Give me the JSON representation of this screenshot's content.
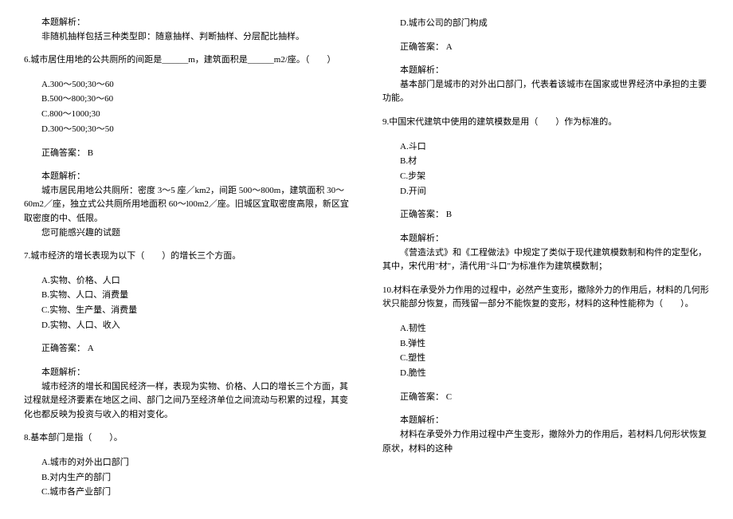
{
  "intro": {
    "heading": "本题解析：",
    "text": "非随机抽样包括三种类型即：随意抽样、判断抽样、分层配比抽样。"
  },
  "q6": {
    "stem": "6.城市居住用地的公共厕所的间距是______m，建筑面积是______m2/座。（　　）",
    "options": {
      "a": "A.300～500;30～60",
      "b": "B.500～800;30～60",
      "c": "C.800～1000;30",
      "d": "D.300～500;30～50"
    },
    "answer_label": "正确答案：",
    "answer_value": "B",
    "analysis_label": "本题解析：",
    "analysis_text": "城市居民用地公共厕所：密度 3～5 座／km2，间距 500～800m，建筑面积 30～60m2／座，独立式公共厕所用地面积 60～l00m2／座。旧城区宜取密度高限，新区宜取密度的中、低限。",
    "extra": "您可能感兴趣的试题"
  },
  "q7": {
    "stem": "7.城市经济的增长表现为以下（　　）的增长三个方面。",
    "options": {
      "a": "A.实物、价格、人口",
      "b": "B.实物、人口、消费量",
      "c": "C.实物、生产量、消费量",
      "d": "D.实物、人口、收入"
    },
    "answer_label": "正确答案：",
    "answer_value": "A",
    "analysis_label": "本题解析：",
    "analysis_text": "城市经济的增长和国民经济一样，表现为实物、价格、人口的增长三个方面，其过程就是经济要素在地区之间、部门之间乃至经济单位之间流动与积累的过程，其变化也都反映为投资与收入的相对变化。"
  },
  "q8": {
    "stem": "8.基本部门是指（　　）。",
    "options": {
      "a": "A.城市的对外出口部门",
      "b": "B.对内生产的部门",
      "c": "C.城市各产业部门",
      "d": "D.城市公司的部门构成"
    },
    "answer_label": "正确答案：",
    "answer_value": "A",
    "analysis_label": "本题解析：",
    "analysis_text": "基本部门是城市的对外出口部门，代表着该城市在国家或世界经济中承担的主要功能。"
  },
  "q9": {
    "stem": "9.中国宋代建筑中使用的建筑模数是用（　　）作为标准的。",
    "options": {
      "a": "A.斗口",
      "b": "B.材",
      "c": "C.步架",
      "d": "D.开间"
    },
    "answer_label": "正确答案：",
    "answer_value": "B",
    "analysis_label": "本题解析：",
    "analysis_text": "《营造法式》和《工程做法》中规定了类似于现代建筑模数制和构件的定型化，其中，宋代用\"材\"，清代用\"斗口\"为标准作为建筑模数制；"
  },
  "q10": {
    "stem": "10.材料在承受外力作用的过程中，必然产生变形，撤除外力的作用后，材料的几何形状只能部分恢复，而残留一部分不能恢复的变形，材料的这种性能称为（　　）。",
    "options": {
      "a": "A.韧性",
      "b": "B.弹性",
      "c": "C.塑性",
      "d": "D.脆性"
    },
    "answer_label": "正确答案：",
    "answer_value": "C",
    "analysis_label": "本题解析：",
    "analysis_text": "材料在承受外力作用过程中产生变形，撤除外力的作用后，若材料几何形状恢复原状，材料的这种"
  }
}
